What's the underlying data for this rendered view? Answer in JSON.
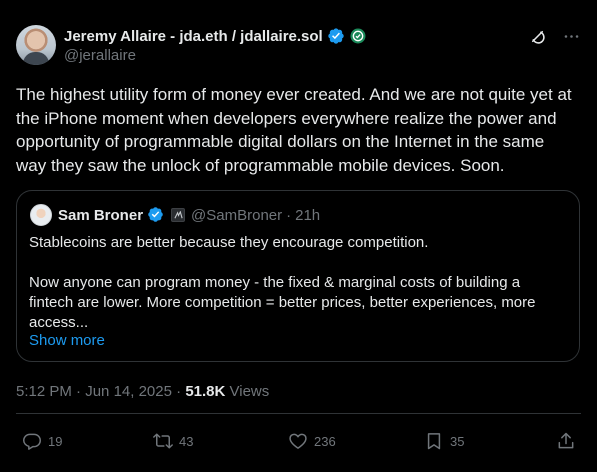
{
  "author": {
    "display_name": "Jeremy Allaire - jda.eth / jdallaire.sol",
    "handle": "@jerallaire"
  },
  "tweet_text": "The highest utility form of money ever created. And we are not quite yet at the iPhone moment when developers everywhere realize the power and opportunity of programmable digital dollars on the Internet in the same way they saw the unlock of programmable mobile devices. Soon.",
  "quote": {
    "display_name": "Sam Broner",
    "handle": "@SamBroner",
    "separator": "·",
    "time": "21h",
    "paragraph_1": "Stablecoins are better because they encourage competition.",
    "paragraph_2": "Now anyone can program money - the fixed & marginal costs of building a fintech are lower. More competition = better prices, better experiences, more access...",
    "show_more": "Show more"
  },
  "meta": {
    "time": "5:12 PM",
    "separator": "·",
    "date": "Jun 14, 2025",
    "separator_2": "·",
    "views_count": "51.8K",
    "views_label": "Views"
  },
  "actions": {
    "replies": "19",
    "reposts": "43",
    "likes": "236",
    "bookmarks": "35"
  },
  "icons": {
    "verified": "verified-badge-icon",
    "affiliate": "affiliate-badge-icon",
    "grok": "grok-icon",
    "more": "more-icon",
    "reply": "reply-icon",
    "repost": "repost-icon",
    "like": "heart-icon",
    "bookmark": "bookmark-icon",
    "share": "share-icon"
  },
  "colors": {
    "background": "#000000",
    "text": "#e7e9ea",
    "secondary": "#71767b",
    "accent": "#1d9bf0",
    "border": "#2f3336"
  }
}
